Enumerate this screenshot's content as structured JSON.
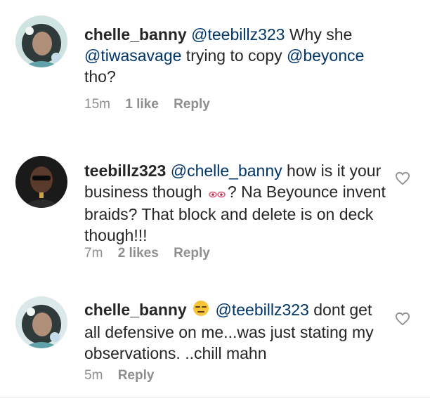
{
  "comments": [
    {
      "username": "chelle_banny",
      "mention1": "@teebillz323",
      "text1": " Why she ",
      "mention2": "@tiwasavage",
      "text2": " trying to copy ",
      "mention3": "@beyonce",
      "text3": " tho?",
      "time": "15m",
      "likes": "1 like",
      "reply": "Reply"
    },
    {
      "username": "teebillz323",
      "mention1": "@chelle_banny",
      "text1": " how is it your business though ",
      "emoji": "eyes-emoji",
      "text2": "? Na Beyounce invent braids? That block and delete is on deck though!!!",
      "time": "7m",
      "likes": "2 likes",
      "reply": "Reply"
    },
    {
      "username": "chelle_banny",
      "emoji": "unamused-face-emoji",
      "mention1": "@teebillz323",
      "text1": " dont get all defensive on me...was just stating my observations. ..chill mahn",
      "time": "5m",
      "reply": "Reply"
    }
  ],
  "icons": {
    "like": "heart-outline-icon"
  },
  "colors": {
    "mention": "#003569",
    "text": "#262626",
    "meta": "#8e8e8e"
  }
}
